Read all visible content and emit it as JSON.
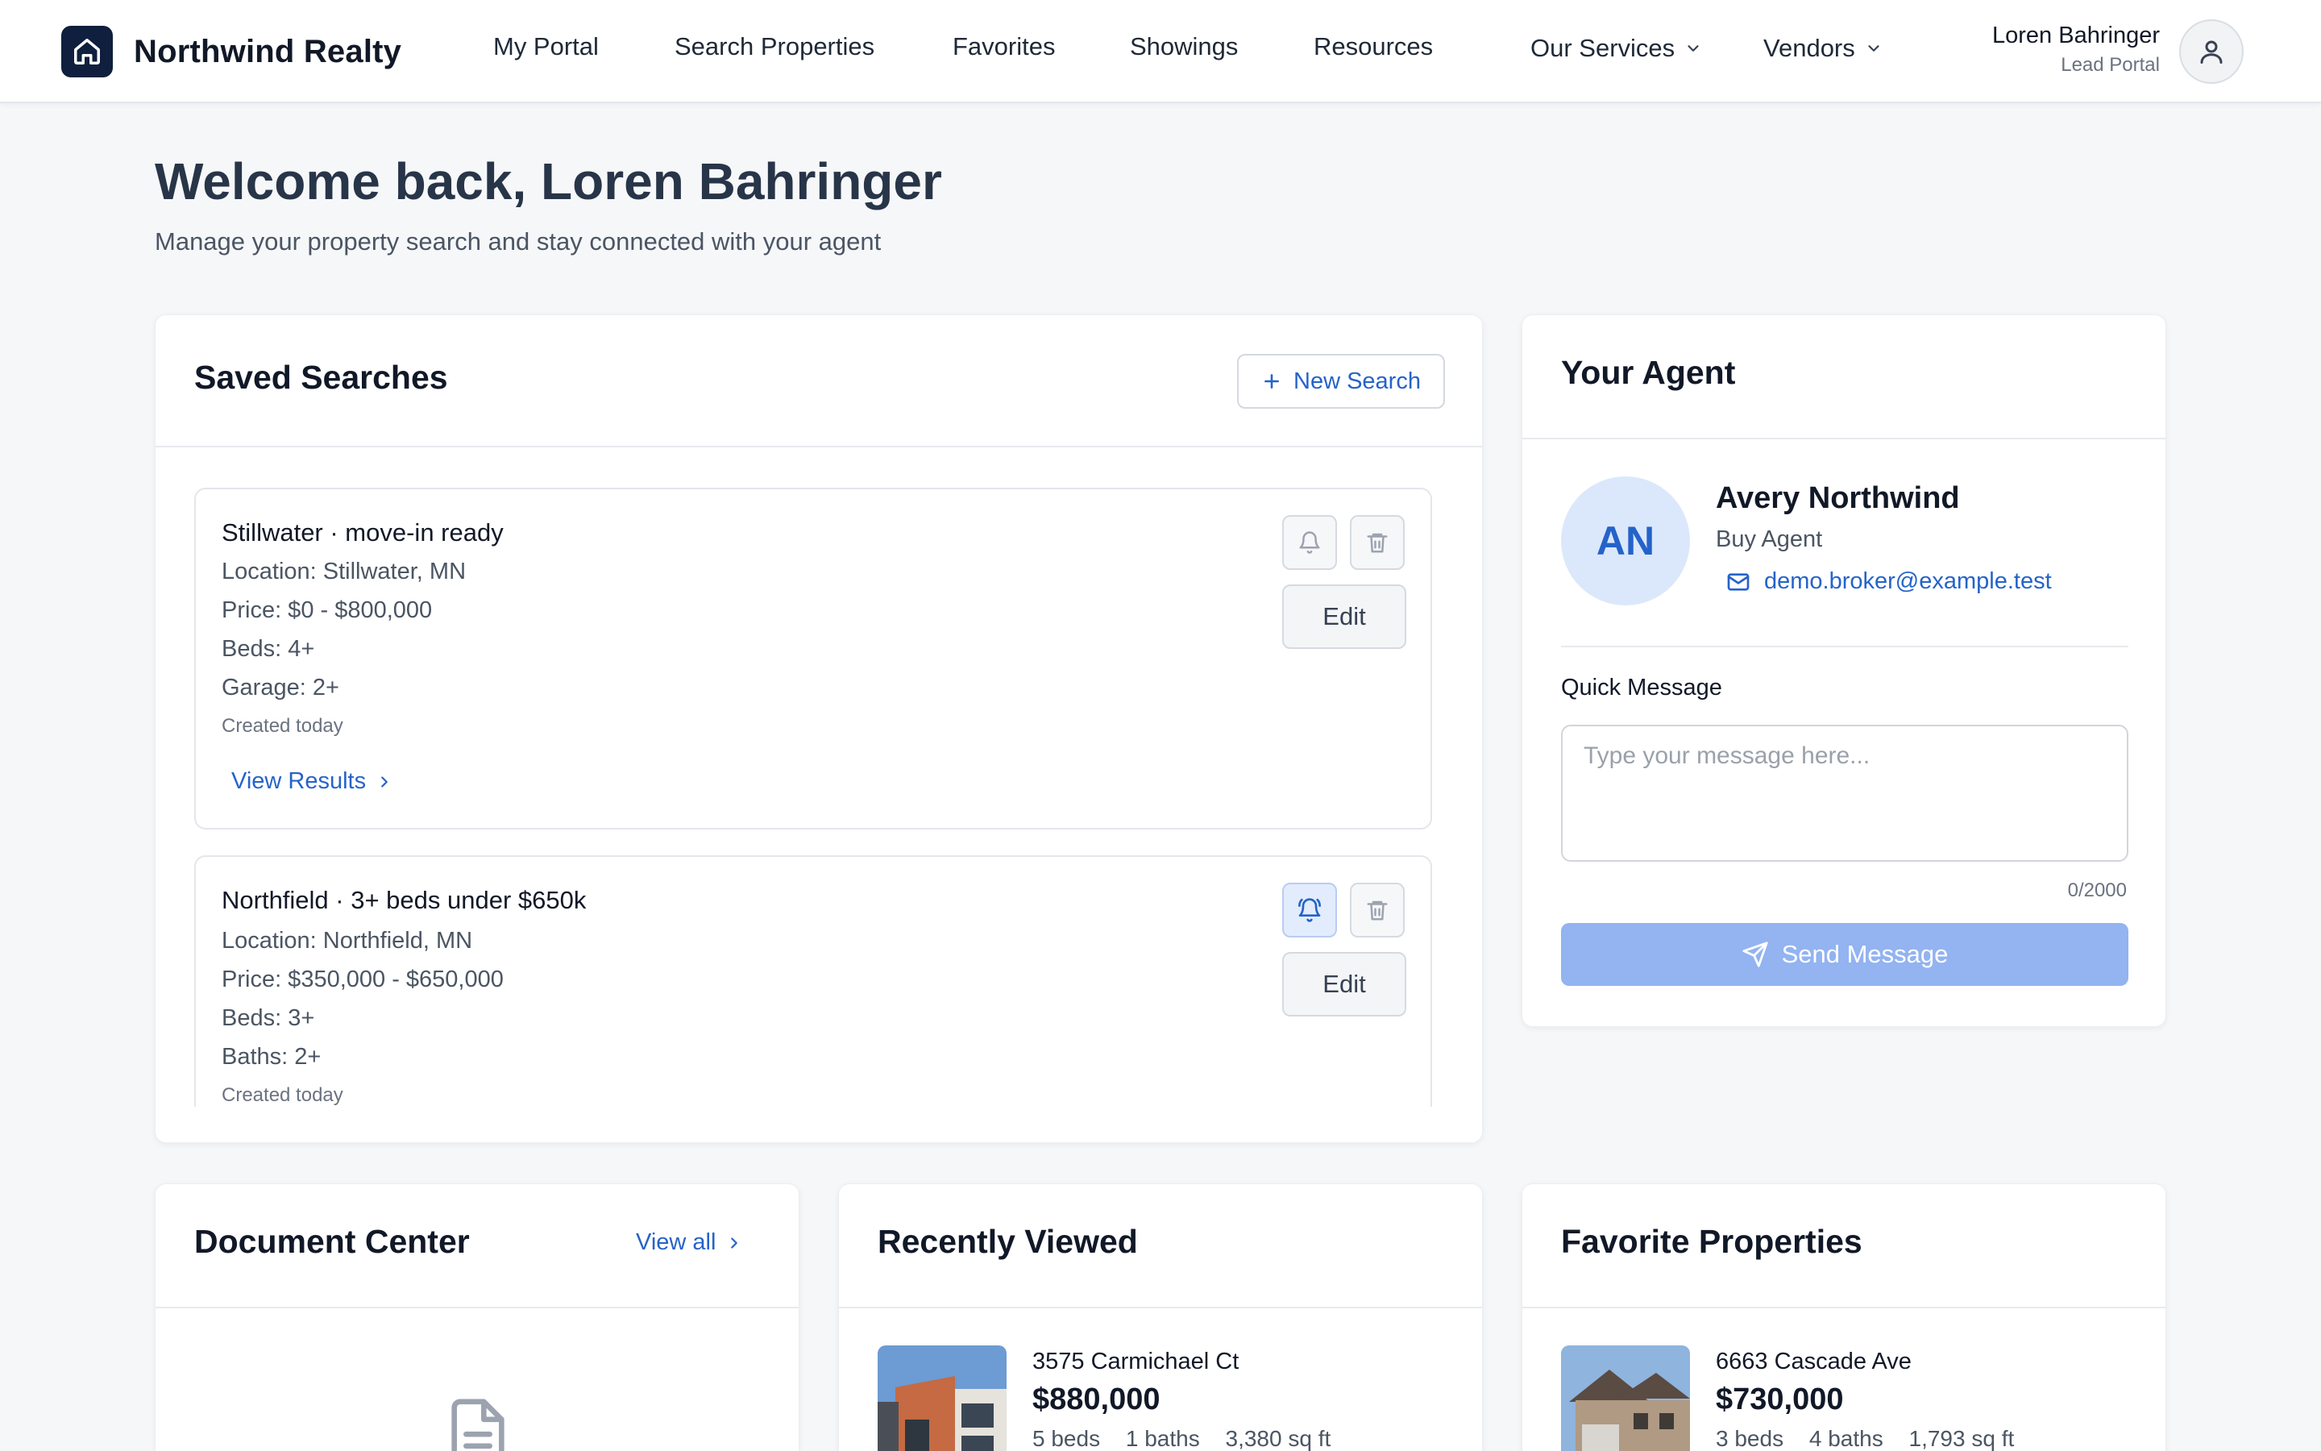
{
  "header": {
    "brand": "Northwind Realty",
    "nav": [
      "My Portal",
      "Search Properties",
      "Favorites",
      "Showings",
      "Resources"
    ],
    "dropdowns": [
      "Our Services",
      "Vendors"
    ],
    "user_name": "Loren Bahringer",
    "user_role": "Lead Portal"
  },
  "welcome": {
    "title": "Welcome back, Loren Bahringer",
    "subtitle": "Manage your property search and stay connected with your agent"
  },
  "saved_searches": {
    "title": "Saved Searches",
    "new_search_label": "New Search",
    "edit_label": "Edit",
    "view_results_label": "View Results",
    "items": [
      {
        "name": "Stillwater · move-in ready",
        "location": "Location: Stillwater, MN",
        "price": "Price: $0 - $800,000",
        "beds": "Beds: 4+",
        "extra": "Garage: 2+",
        "created": "Created today",
        "alerts_on": false
      },
      {
        "name": "Northfield · 3+ beds under $650k",
        "location": "Location: Northfield, MN",
        "price": "Price: $350,000 - $650,000",
        "beds": "Beds: 3+",
        "extra": "Baths: 2+",
        "created": "Created today",
        "alerts_on": true
      }
    ]
  },
  "agent": {
    "title": "Your Agent",
    "initials": "AN",
    "name": "Avery Northwind",
    "role": "Buy Agent",
    "email": "demo.broker@example.test",
    "quick_message_label": "Quick Message",
    "message_placeholder": "Type your message here...",
    "message_value": "",
    "char_count": "0/2000",
    "send_label": "Send Message"
  },
  "documents": {
    "title": "Document Center",
    "view_all_label": "View all"
  },
  "recently_viewed": {
    "title": "Recently Viewed",
    "items": [
      {
        "address": "3575 Carmichael Ct",
        "price": "$880,000",
        "beds": "5 beds",
        "baths": "1 baths",
        "sqft": "3,380 sq ft"
      }
    ]
  },
  "favorites": {
    "title": "Favorite Properties",
    "items": [
      {
        "address": "6663 Cascade Ave",
        "price": "$730,000",
        "beds": "3 beds",
        "baths": "4 baths",
        "sqft": "1,793 sq ft"
      }
    ]
  },
  "colors": {
    "brand_dark": "#0f1f3d",
    "accent_blue": "#2563c9",
    "send_button_disabled": "#93b3f1",
    "page_bg": "#f6f7f9"
  }
}
